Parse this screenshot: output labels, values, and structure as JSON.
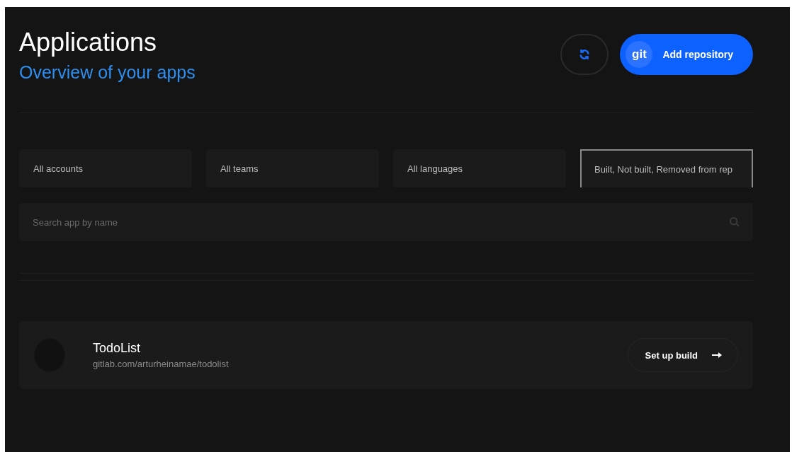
{
  "header": {
    "title": "Applications",
    "subtitle": "Overview of your apps"
  },
  "actions": {
    "add_button": {
      "badge": "git",
      "label": "Add repository"
    }
  },
  "filters": [
    {
      "label": "All accounts",
      "focused": false
    },
    {
      "label": "All teams",
      "focused": false
    },
    {
      "label": "All languages",
      "focused": false
    },
    {
      "label": "Built, Not built, Removed from rep",
      "focused": true
    }
  ],
  "search": {
    "placeholder": "Search app by name"
  },
  "apps": [
    {
      "name": "TodoList",
      "url": "gitlab.com/arturheinamae/todolist",
      "action": "Set up build"
    }
  ]
}
